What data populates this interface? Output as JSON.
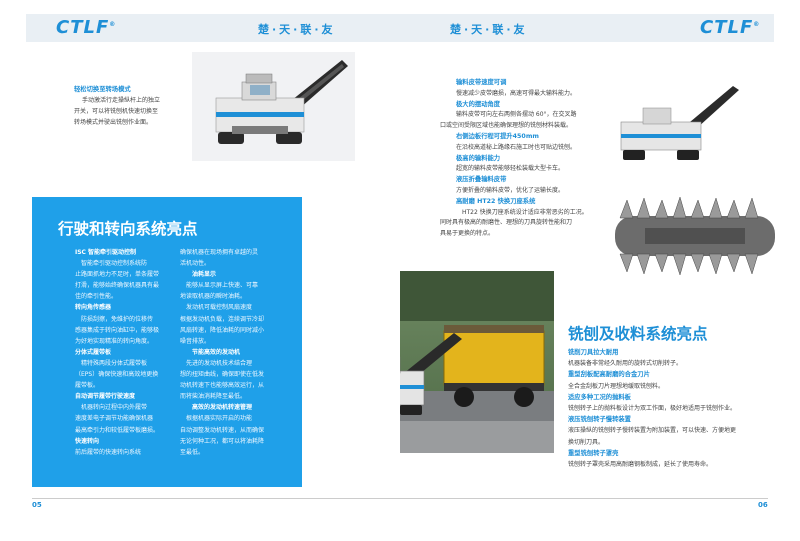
{
  "header": {
    "logo_left": "CTLF",
    "logo_right": "CTLF",
    "logo_mark": "®",
    "slogan_left": "楚·天·联·友",
    "slogan_right": "楚·天·联·友"
  },
  "left_page": {
    "caption_top": {
      "title": "轻松切换至转场模式",
      "lines": [
        "手动激活行走操纵杆上的独立",
        "开关，可以将铣刨机快速切换至",
        "转场模式并驶出铣刨作业面。"
      ]
    },
    "panel": {
      "title": "行驶和转向系统亮点",
      "col1": [
        {
          "t": "ISC 智能牵引驱动控制",
          "b": [
            "智能牵引驱动控制系统防",
            "止路面抓地力不足时，单条履带",
            "打滑，能够始终确保机器具有最",
            "佳的牵引性能。"
          ]
        },
        {
          "t": "转向角传感器",
          "b": [
            "防损刮擦，免维护的位移传",
            "感器集成于转向油缸中，能够极",
            "为好地实现精准的转向角度。"
          ]
        },
        {
          "t": "分体式履带板",
          "b": [
            "精特殊两段分体式履带板",
            "（EPS）确保快速和高效地更换",
            "履带板。"
          ]
        },
        {
          "t": "自动调节履带行驶速度",
          "b": [
            "机器转向过程中内外履带",
            "速度差电子调节功能确保机器",
            "最高牵引力和较低履带板磨损。"
          ]
        },
        {
          "t": "快速转向",
          "b": [
            "前后履带的快速转向系统"
          ]
        }
      ],
      "col2": [
        {
          "t": "",
          "b": [
            "确保机器在现场拥有卓越的灵",
            "活机动性。"
          ]
        },
        {
          "t": "油耗显示",
          "b": [
            "能够从显示屏上快速、可靠",
            "地读取机器的瞬时油耗。"
          ]
        },
        {
          "t": "",
          "b": [
            "发动机可载控制风扇速度",
            "根据发动机负载，连续调节冷却",
            "风扇转速，降低油耗的同时减小",
            "噪音排放。"
          ]
        },
        {
          "t": "节能高效的发动机",
          "b": [
            "先进的发动机技术结合理",
            "想的扭矩曲线，确保即使在低发",
            "动机转速下也能够高效运行，从",
            "而将柴油消耗降至最低。"
          ]
        },
        {
          "t": "高效的发动机转速管理",
          "b": [
            "根据机器实际开启的功能",
            "自动调整发动机转速，从而确保",
            "无论何种工况，都可以将油耗降",
            "至最低。"
          ]
        }
      ]
    },
    "page_number": "05"
  },
  "right_page": {
    "caption_top": [
      {
        "t": "输料皮带速度可调",
        "b": [
          "慢速减少皮带磨损，高速可得最大输料能力。"
        ]
      },
      {
        "t": "极大的摆动角度",
        "b": [
          "输料皮带可向左右两侧各摆动 60°，在交叉路",
          "口或空间受限区域也能确保理想的铣刨材料装载。"
        ]
      },
      {
        "t": "右侧边板行程可提升450mm",
        "b": [
          "在沿校高道秘上路缘石施工时也可贴边铣刨。"
        ]
      },
      {
        "t": "极高的输料能力",
        "b": [
          "超宽的输料皮带能够轻松装载大型卡车。"
        ]
      },
      {
        "t": "液压折叠输料皮带",
        "b": [
          "方便折叠的输料皮带，优化了运输长度。"
        ]
      },
      {
        "t": "高耐磨 HT22 快换刀座系统",
        "b": [
          "HT22 快换刀座系统设计适应非常恶劣的工况。",
          "同时具有极高的耐磨性、理想的刀具旋转性能和刀",
          "具易于更换的特点。"
        ]
      }
    ],
    "section_title": "铣刨及收料系统亮点",
    "features": [
      {
        "t": "铣削刀具拉大耐用",
        "b": [
          "机器装备非常经久耐用的旋转式切削转子。"
        ]
      },
      {
        "t": "重型刮板配高耐磨的合金刀片",
        "b": [
          "全合金刮板刀片理想地缓取铣刨料。"
        ]
      },
      {
        "t": "适应多种工况的抛料板",
        "b": [
          "铣刨转子上的抛料板设计为双工作面，极好地适用于铣刨作业。"
        ]
      },
      {
        "t": "液压铣刨转子慢转装置",
        "b": [
          "液压操纵的铣刨转子慢转装置为附加装置，可以快速、方便地更",
          "换切削刀具。"
        ]
      },
      {
        "t": "重型铣刨转子罩壳",
        "b": [
          "铣刨转子罩壳采用高耐磨钢板制成，延长了使用寿命。"
        ]
      }
    ],
    "page_number": "06"
  },
  "colors": {
    "brand_blue": "#1e8fd6",
    "panel_blue": "#1fa0e9",
    "header_bg": "#e9eff4"
  }
}
